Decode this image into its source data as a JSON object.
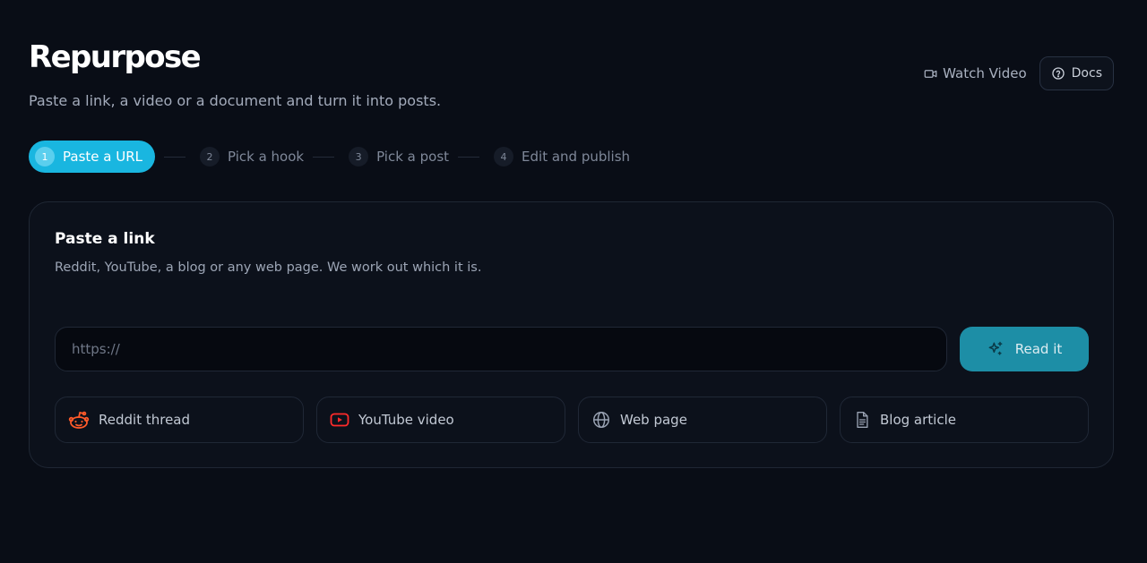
{
  "header": {
    "title": "Repurpose",
    "subtitle": "Paste a link, a video or a document and turn it into posts.",
    "watch_video_label": "Watch Video",
    "docs_label": "Docs"
  },
  "stepper": {
    "steps": [
      {
        "number": "1",
        "label": "Paste a URL",
        "active": true
      },
      {
        "number": "2",
        "label": "Pick a hook",
        "active": false
      },
      {
        "number": "3",
        "label": "Pick a post",
        "active": false
      },
      {
        "number": "4",
        "label": "Edit and publish",
        "active": false
      }
    ]
  },
  "card": {
    "title": "Paste a link",
    "description": "Reddit, YouTube, a blog or any web page. We work out which it is.",
    "input": {
      "value": "",
      "placeholder": "https://"
    },
    "read_button_label": "Read it",
    "sources": [
      {
        "label": "Reddit thread",
        "icon": "reddit-icon"
      },
      {
        "label": "YouTube video",
        "icon": "youtube-icon"
      },
      {
        "label": "Web page",
        "icon": "globe-icon"
      },
      {
        "label": "Blog article",
        "icon": "document-icon"
      }
    ]
  },
  "colors": {
    "background": "#090d16",
    "accent": "#19b6e0",
    "button": "#1d8ea6",
    "reddit": "#ff5a2a",
    "youtube": "#ff2b2b"
  }
}
